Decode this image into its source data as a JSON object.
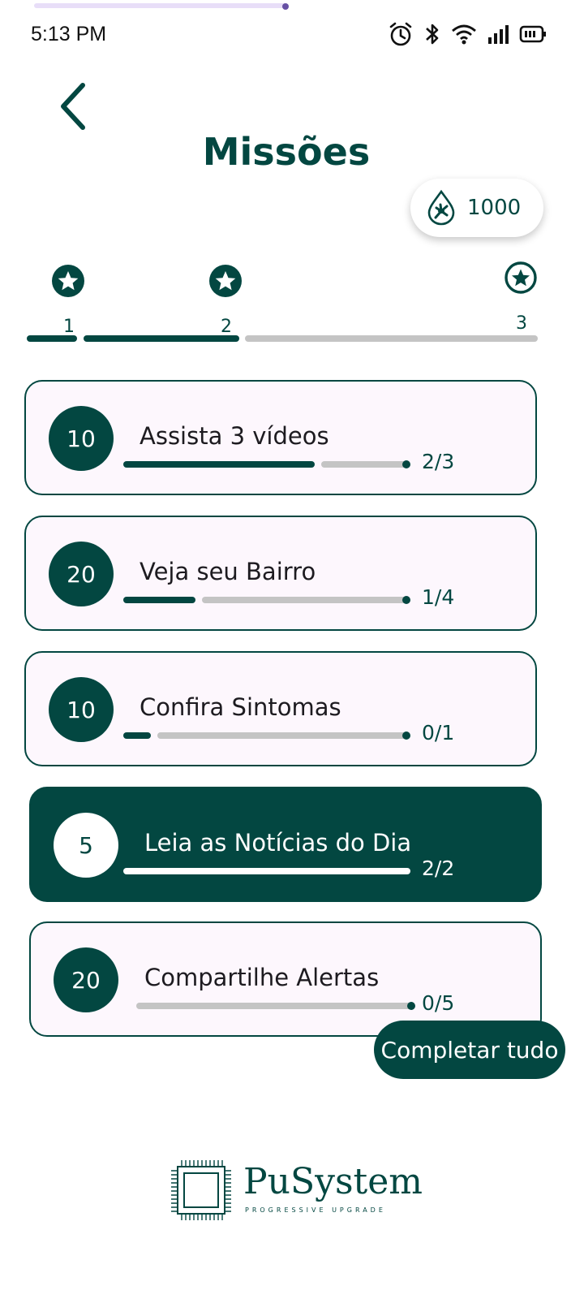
{
  "status_bar": {
    "time": "5:13 PM",
    "icons": [
      "alarm-icon",
      "bluetooth-icon",
      "wifi-icon",
      "signal-icon",
      "battery-icon"
    ]
  },
  "header": {
    "back_icon": "chevron-left-icon",
    "title": "Missões"
  },
  "points": {
    "icon": "drop-icon",
    "value": "1000"
  },
  "levels": [
    {
      "label": "1",
      "achieved": true
    },
    {
      "label": "2",
      "achieved": true
    },
    {
      "label": "3",
      "achieved": false
    }
  ],
  "missions": [
    {
      "reward": "10",
      "title": "Assista 3 vídeos",
      "count": "2/3",
      "progress": 0.667,
      "completed": false
    },
    {
      "reward": "20",
      "title": "Veja seu Bairro",
      "count": "1/4",
      "progress": 0.25,
      "completed": false
    },
    {
      "reward": "10",
      "title": "Confira Sintomas",
      "count": "0/1",
      "progress": 0,
      "completed": false
    },
    {
      "reward": "5",
      "title": "Leia as Notícias do Dia",
      "count": "2/2",
      "progress": 1,
      "completed": true
    },
    {
      "reward": "20",
      "title": "Compartilhe Alertas",
      "count": "0/5",
      "progress": 0,
      "completed": false
    }
  ],
  "actions": {
    "complete_all_label": "Completar tudo"
  },
  "brand": {
    "name": "PuSystem",
    "tagline": "PROGRESSIVE UPGRADE"
  },
  "colors": {
    "primary": "#034741",
    "card_background": "#fdf7fd",
    "track": "#c4c4c4"
  }
}
